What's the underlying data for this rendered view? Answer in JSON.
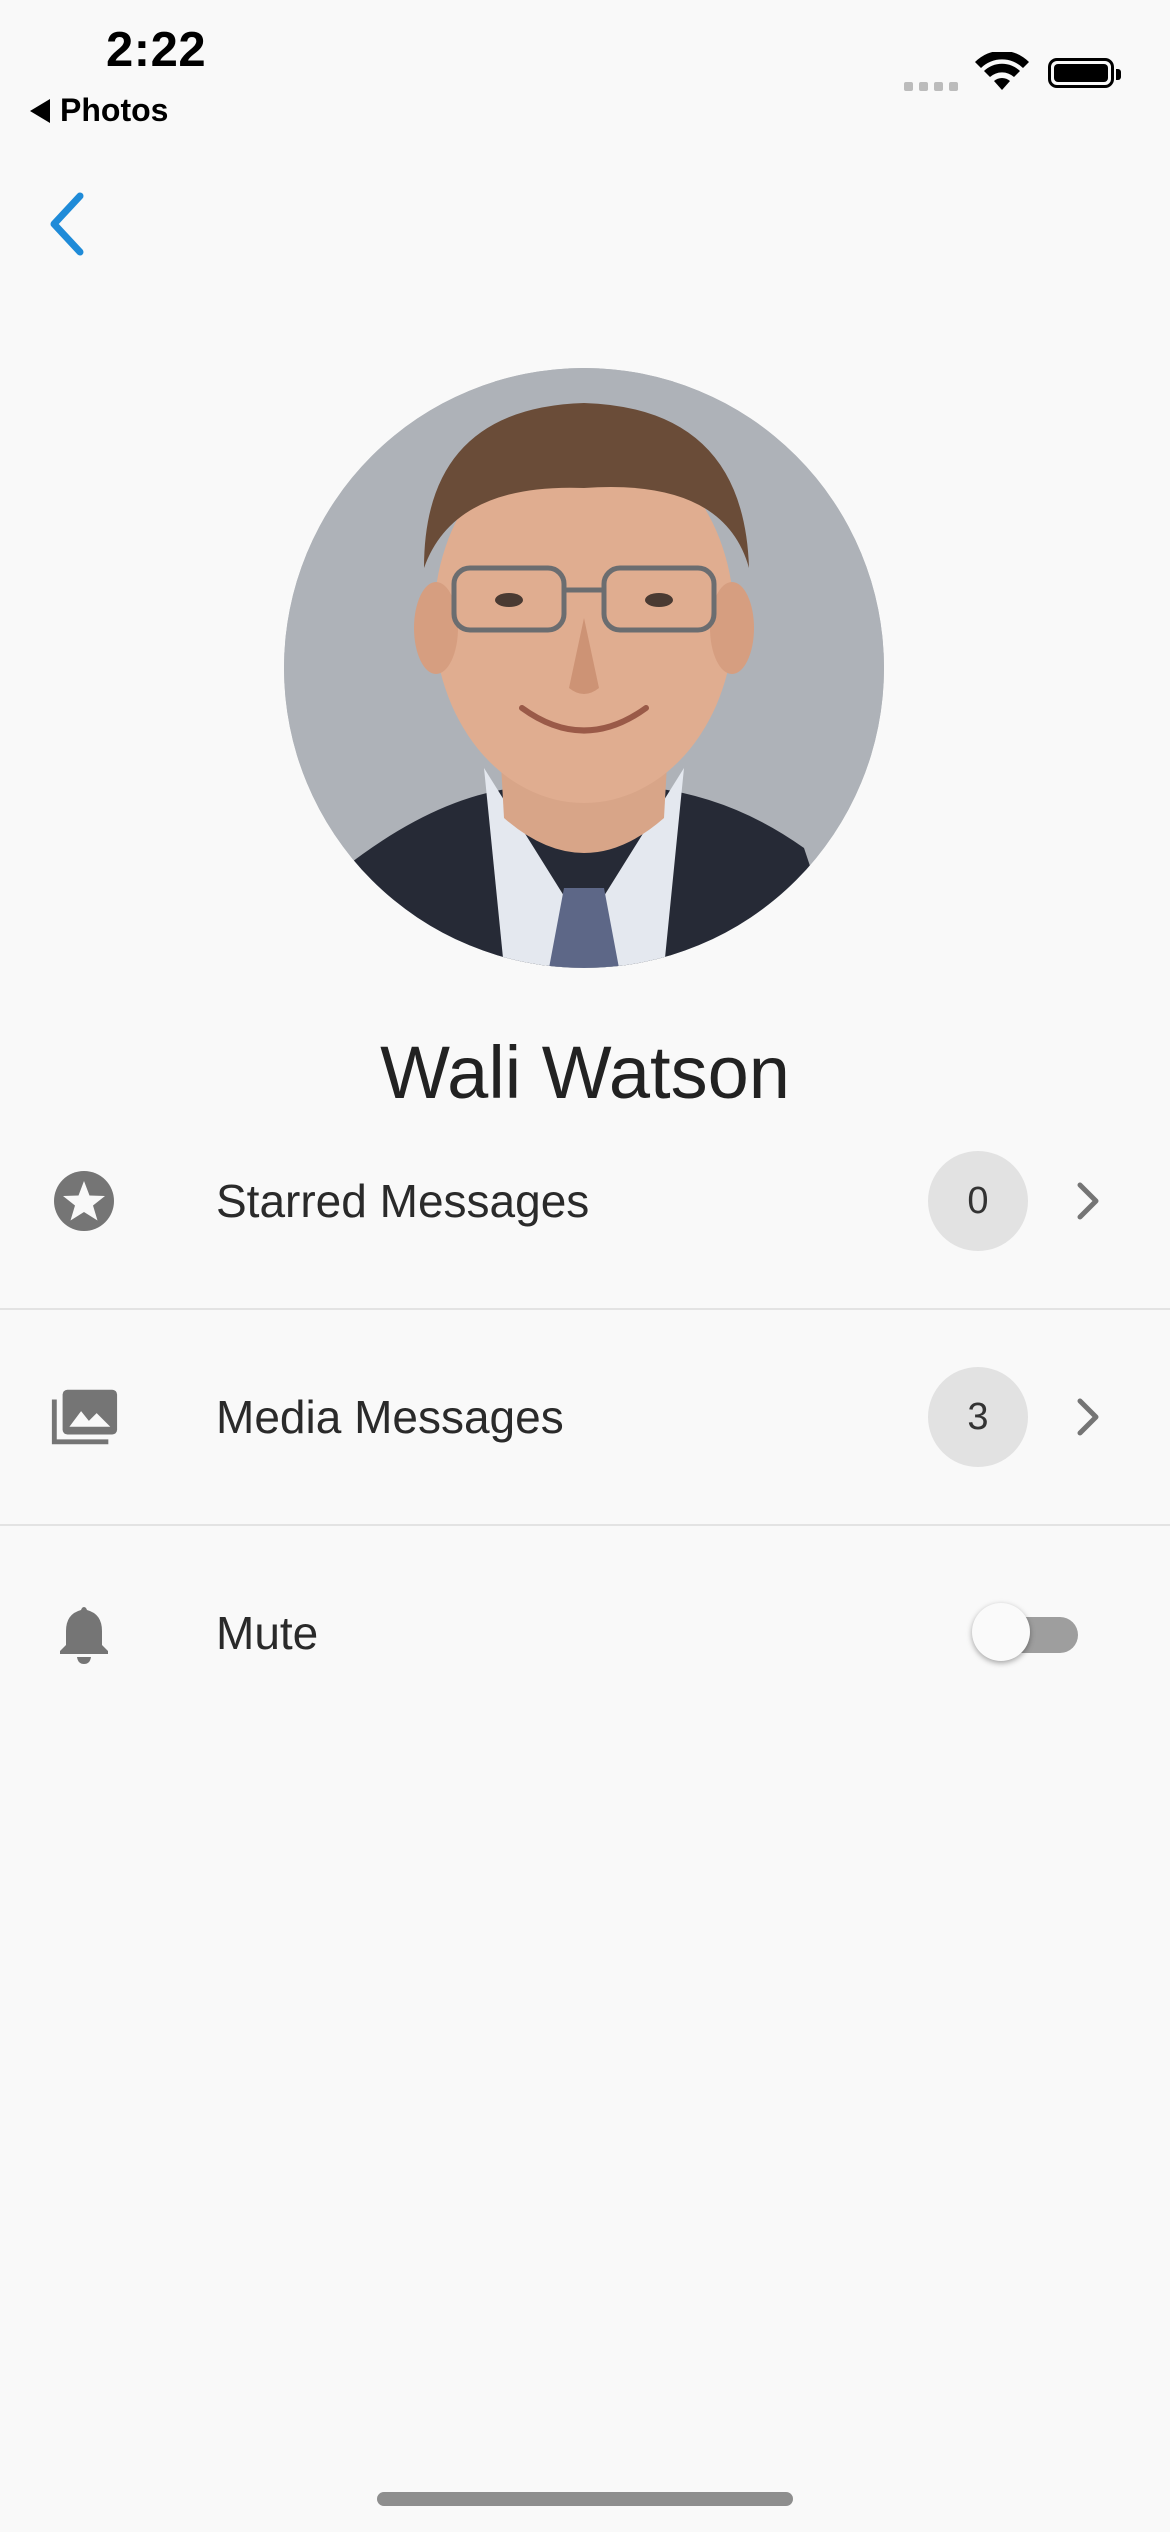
{
  "status_bar": {
    "time": "2:22",
    "back_app": "Photos"
  },
  "colors": {
    "accent": "#1f8bd8",
    "icon_gray": "#757575",
    "badge_bg": "#e2e2e2",
    "toggle_track_off": "#9e9e9e"
  },
  "nav": {
    "back_icon": "chevron-left-icon"
  },
  "profile": {
    "name": "Wali Watson"
  },
  "rows": {
    "starred": {
      "icon": "star-circle-icon",
      "label": "Starred Messages",
      "count": "0"
    },
    "media": {
      "icon": "photo-library-icon",
      "label": "Media Messages",
      "count": "3"
    },
    "mute": {
      "icon": "bell-icon",
      "label": "Mute",
      "enabled": false
    }
  }
}
